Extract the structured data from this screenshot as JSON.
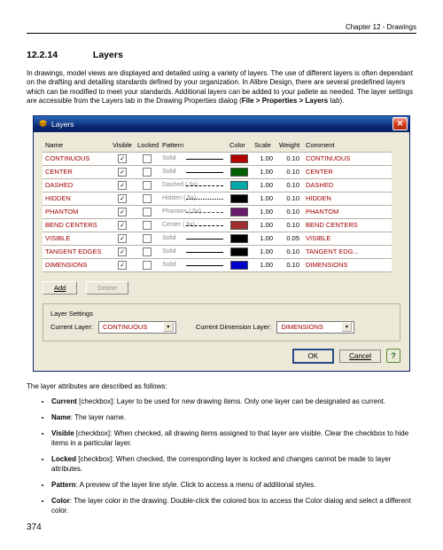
{
  "chapter": "Chapter 12 - Drawings",
  "section_num": "12.2.14",
  "section_title": "Layers",
  "intro_text": "In drawings, model views are displayed and detailed using a variety of layers. The use of different layers is often dependant on the drafting and detailing standards defined by your organization. In Alibre Design, there are several predefined layers which can be modified to meet your standards. Additional layers can be added to your pallete as needed. The layer settings are accessible from the Layers tab in the Drawing Properties dialog (",
  "intro_bold": "File > Properties > Layers",
  "intro_tail": " tab).",
  "dialog": {
    "title": "Layers",
    "headers": [
      "Name",
      "Visible",
      "Locked",
      "Pattern",
      "Color",
      "Scale",
      "Weight",
      "Comment"
    ],
    "rows": [
      {
        "name": "CONTINUOUS",
        "visible": true,
        "locked": false,
        "pattern": "Solid",
        "patstyle": "solidln",
        "color": "#b00000",
        "scale": "1.00",
        "weight": "0.10",
        "comment": "CONTINUOUS"
      },
      {
        "name": "CENTER",
        "visible": true,
        "locked": false,
        "pattern": "Solid",
        "patstyle": "solidln",
        "color": "#006000",
        "scale": "1.00",
        "weight": "0.10",
        "comment": "CENTER"
      },
      {
        "name": "DASHED",
        "visible": true,
        "locked": false,
        "pattern": "Dashed (.5x)",
        "patstyle": "dash-l",
        "color": "#00a8a8",
        "scale": "1.00",
        "weight": "0.10",
        "comment": "DASHED"
      },
      {
        "name": "HIDDEN",
        "visible": true,
        "locked": false,
        "pattern": "Hidden (.5x)",
        "patstyle": "dash-s",
        "color": "#000000",
        "scale": "1.00",
        "weight": "0.10",
        "comment": "HIDDEN"
      },
      {
        "name": "PHANTOM",
        "visible": true,
        "locked": false,
        "pattern": "Phantom (.5x)",
        "patstyle": "phantomln",
        "color": "#6a1a6a",
        "scale": "1.00",
        "weight": "0.10",
        "comment": "PHANTOM"
      },
      {
        "name": "BEND CENTERS",
        "visible": true,
        "locked": false,
        "pattern": "Center (.5x)",
        "patstyle": "dash-l",
        "color": "#a03030",
        "scale": "1.00",
        "weight": "0.10",
        "comment": "BEND CENTERS"
      },
      {
        "name": "VISIBLE",
        "visible": true,
        "locked": false,
        "pattern": "Solid",
        "patstyle": "solidln",
        "color": "#000000",
        "scale": "1.00",
        "weight": "0.05",
        "comment": "VISIBLE"
      },
      {
        "name": "TANGENT EDGES",
        "visible": true,
        "locked": false,
        "pattern": "Solid",
        "patstyle": "solidln",
        "color": "#000000",
        "scale": "1.00",
        "weight": "0.10",
        "comment": "TANGENT EDG..."
      },
      {
        "name": "DIMENSIONS",
        "visible": true,
        "locked": false,
        "pattern": "Solid",
        "patstyle": "solidln",
        "color": "#0000c8",
        "scale": "1.00",
        "weight": "0.10",
        "comment": "DIMENSIONS"
      }
    ],
    "add_btn": "Add",
    "delete_btn": "Delete",
    "layer_settings_label": "Layer Settings",
    "current_layer_label": "Current Layer:",
    "current_layer_value": "CONTINUOUS",
    "current_dim_label": "Current Dimension Layer:",
    "current_dim_value": "DIMENSIONS",
    "ok": "OK",
    "cancel": "Cancel"
  },
  "desc_intro": "The layer attributes are described as follows:",
  "attrs": [
    {
      "term": "Current",
      "suffix": " [checkbox]: Layer to be used for new drawing items. Only one layer can be designated as current."
    },
    {
      "term": "Name",
      "suffix": ": The layer name."
    },
    {
      "term": "Visible",
      "suffix": " [checkbox]: When checked, all drawing items assigned to that layer are visible. Clear the checkbox to hide items in a particular layer."
    },
    {
      "term": "Locked",
      "suffix": " [checkbox]: When checked, the corresponding layer is locked and changes cannot be made to layer attributes."
    },
    {
      "term": "Pattern",
      "suffix": ": A preview of the layer line style. Click to access a menu of additional styles."
    },
    {
      "term": "Color",
      "suffix": ": The layer color in the drawing. Double-click the colored box to access the Color dialog and select a different color."
    }
  ],
  "page_number": "374"
}
